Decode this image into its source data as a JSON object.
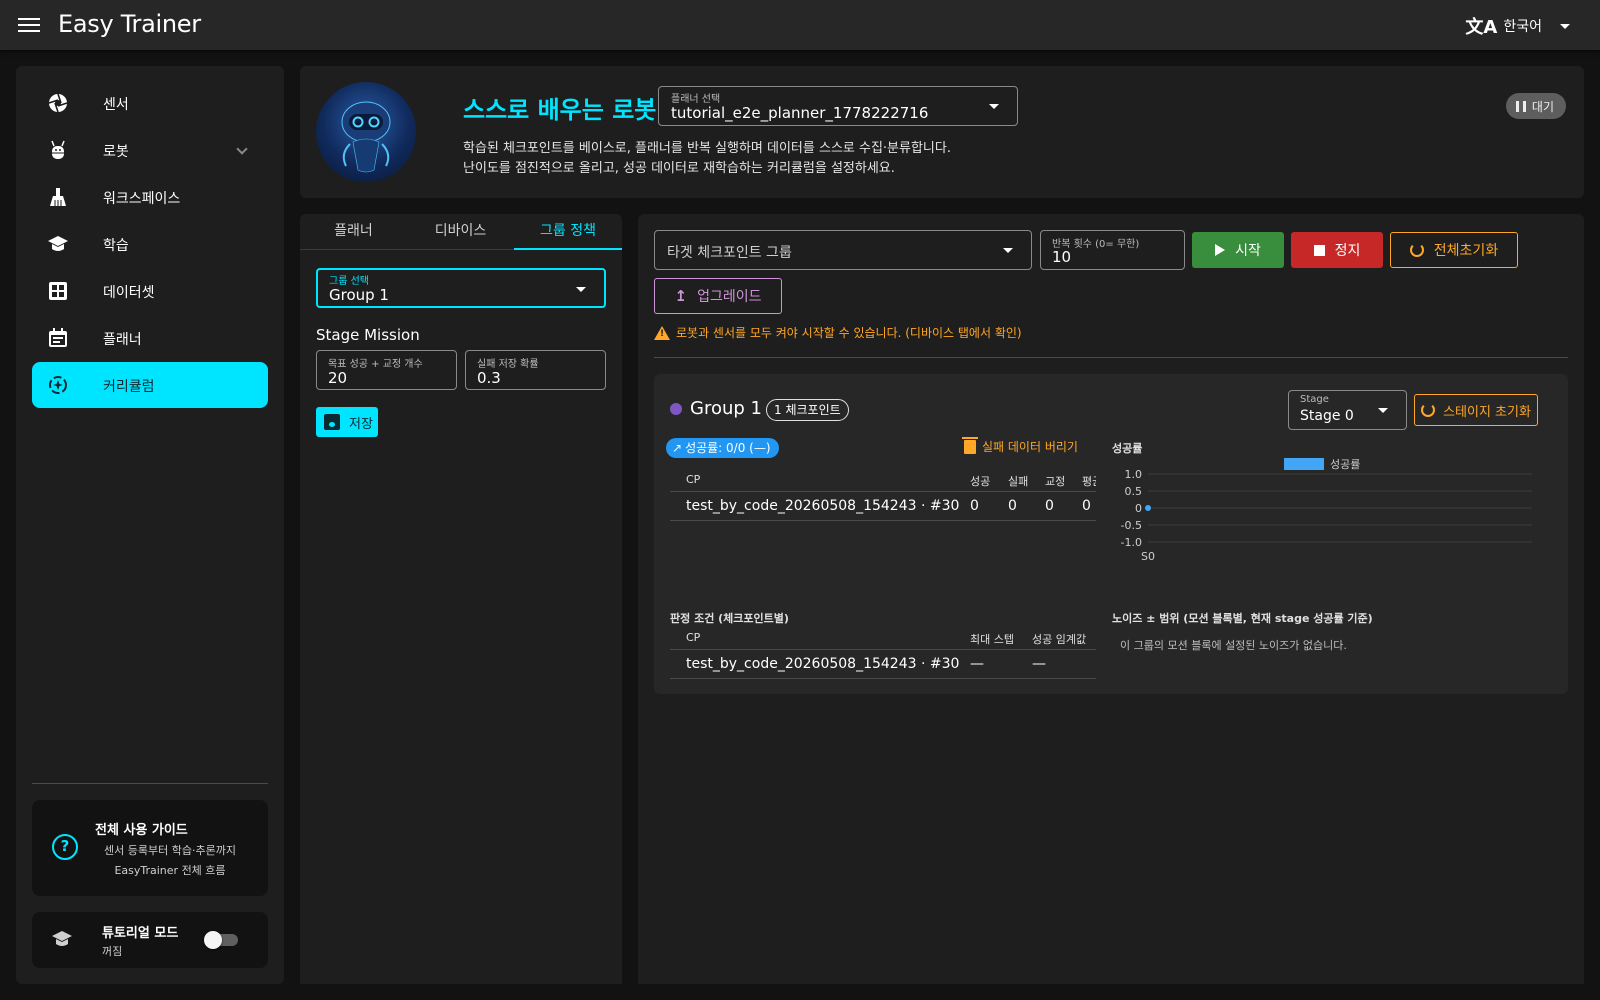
{
  "app": {
    "title": "Easy Trainer",
    "language": "한국어"
  },
  "sidebar": {
    "items": [
      {
        "label": "센서",
        "icon": "camera-aperture-icon"
      },
      {
        "label": "로봇",
        "icon": "robot-icon"
      },
      {
        "label": "워크스페이스",
        "icon": "flask-icon"
      },
      {
        "label": "학습",
        "icon": "graduation-cap-icon"
      },
      {
        "label": "데이터셋",
        "icon": "grid-icon"
      },
      {
        "label": "플래너",
        "icon": "calendar-icon"
      },
      {
        "label": "커리큘럼",
        "icon": "curriculum-icon"
      }
    ],
    "active": "커리큘럼",
    "guide": {
      "title": "전체 사용 가이드",
      "line1": "센서 등록부터 학습·추론까지",
      "line2": "EasyTrainer 전체 흐름"
    },
    "tutorial": {
      "title": "튜토리얼 모드",
      "status": "꺼짐",
      "enabled": false
    }
  },
  "header": {
    "title": "스스로 배우는 로봇",
    "planner_label": "플래너 선택",
    "planner_value": "tutorial_e2e_planner_1778222716",
    "desc1": "학습된 체크포인트를 베이스로, 플래너를 반복 실행하며 데이터를 스스로 수집·분류합니다.",
    "desc2": "난이도를 점진적으로 올리고, 성공 데이터로 재학습하는 커리큘럼을 설정하세요.",
    "status": "대기"
  },
  "left_panel": {
    "tabs": [
      "플래너",
      "디바이스",
      "그룹 정책"
    ],
    "active_tab": "그룹 정책",
    "group_select_label": "그룹 선택",
    "group_select_value": "Group 1",
    "stage_mission": "Stage Mission",
    "target_label": "목표 성공 + 교정 개수",
    "target_value": "20",
    "fail_label": "실패 저장 확률",
    "fail_value": "0.3",
    "save_label": "저장"
  },
  "right_panel": {
    "target_group_placeholder": "타겟 체크포인트 그룹",
    "repeat_label": "반복 횟수 (0= 무한)",
    "repeat_value": "10",
    "start_label": "시작",
    "stop_label": "정지",
    "reset_all_label": "전체초기화",
    "upgrade_label": "업그레이드",
    "warning": "로봇과 센서를 모두 켜야 시작할 수 있습니다. (디바이스 탭에서 확인)",
    "group": {
      "name": "Group 1",
      "chip": "1 체크포인트",
      "stage_label": "Stage",
      "stage_value": "Stage 0",
      "stage_reset_label": "스테이지 초기화",
      "success_chip": "성공률: 0/0 (—)",
      "discard_label": "실패 데이터 버리기",
      "stats_table": {
        "headers": [
          "CP",
          "성공",
          "실패",
          "교정",
          "평균"
        ],
        "rows": [
          [
            "test_by_code_20260508_154243 · #30",
            "0",
            "0",
            "0",
            "0"
          ]
        ]
      },
      "criteria_title": "판정 조건 (체크포인트별)",
      "criteria_table": {
        "headers": [
          "CP",
          "최대 스텝",
          "성공 임계값"
        ],
        "rows": [
          [
            "test_by_code_20260508_154243 · #30",
            "—",
            "—"
          ]
        ]
      },
      "noise_title": "노이즈 ± 범위 (모션 블록별, 현재 stage 성공률 기준)",
      "noise_empty": "이 그룹의 모션 블록에 설정된 노이즈가 없습니다."
    }
  },
  "chart_data": {
    "type": "line",
    "title": "성공률",
    "legend": [
      "성공률"
    ],
    "legend_position": "top",
    "categories": [
      "S0"
    ],
    "series": [
      {
        "name": "성공률",
        "values": [
          0
        ],
        "color": "#42a5f5"
      }
    ],
    "yticks": [
      "1.0",
      "0.5",
      "0",
      "-0.5",
      "-1.0"
    ],
    "ylim": [
      -1.0,
      1.0
    ],
    "grid": true
  },
  "colors": {
    "accent": "#00e5ff",
    "start": "#388e3c",
    "stop": "#c62828",
    "warning": "#ffa726",
    "upgrade": "#ce93d8",
    "group_dot": "#7e57c2",
    "success_chip": "#2196f3"
  }
}
